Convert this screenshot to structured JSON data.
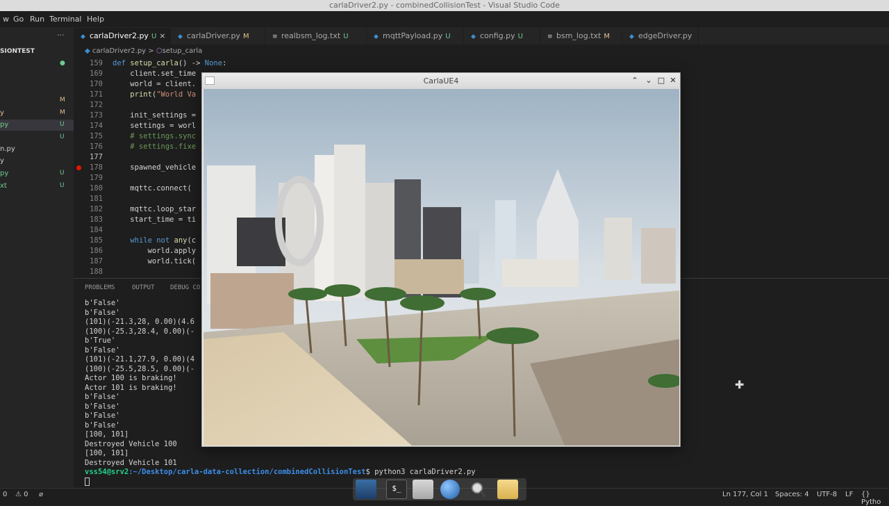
{
  "window": {
    "title": "carlaDriver2.py - combinedCollisionTest - Visual Studio Code"
  },
  "menu": {
    "items": [
      "w",
      "Go",
      "Run",
      "Terminal",
      "Help"
    ]
  },
  "sidebar": {
    "more": "···",
    "project": "SIONTEST",
    "files": [
      {
        "name": "",
        "status": "",
        "dot": "●"
      },
      {
        "name": "",
        "status": "M"
      },
      {
        "name": "y",
        "status": "M"
      },
      {
        "name": "py",
        "status": "U",
        "selected": true
      },
      {
        "name": "",
        "status": "U"
      },
      {
        "name": "n.py",
        "status": ""
      },
      {
        "name": "y",
        "status": ""
      },
      {
        "name": "py",
        "status": "U"
      },
      {
        "name": "xt",
        "status": "U"
      }
    ]
  },
  "tabs": [
    {
      "label": "carlaDriver2.py",
      "status": "U",
      "active": true,
      "close": "×"
    },
    {
      "label": "carlaDriver.py",
      "status": "M"
    },
    {
      "label": "realbsm_log.txt",
      "status": "U"
    },
    {
      "label": "mqttPayload.py",
      "status": "U"
    },
    {
      "label": "config.py",
      "status": "U"
    },
    {
      "label": "bsm_log.txt",
      "status": "M"
    },
    {
      "label": "edgeDriver.py",
      "status": ""
    }
  ],
  "breadcrumb": {
    "file": "carlaDriver2.py",
    "sep": ">",
    "symbol": "setup_carla"
  },
  "editor": {
    "lines": [
      {
        "n": "159",
        "parts": [
          [
            "kw",
            "def "
          ],
          [
            "fn",
            "setup_carla"
          ],
          [
            "",
            "() -> "
          ],
          [
            "kw",
            "None"
          ],
          [
            "",
            ":"
          ]
        ]
      },
      {
        "n": "169",
        "parts": [
          [
            "",
            "    client.set_time"
          ]
        ]
      },
      {
        "n": "170",
        "parts": [
          [
            "",
            "    world = client."
          ]
        ]
      },
      {
        "n": "171",
        "parts": [
          [
            "",
            "    "
          ],
          [
            "fn",
            "print"
          ],
          [
            "",
            "("
          ],
          [
            "str",
            "\"World Va"
          ]
        ]
      },
      {
        "n": "172",
        "parts": []
      },
      {
        "n": "173",
        "parts": [
          [
            "",
            "    init_settings ="
          ]
        ]
      },
      {
        "n": "174",
        "parts": [
          [
            "",
            "    settings = worl"
          ]
        ]
      },
      {
        "n": "175",
        "parts": [
          [
            "cm",
            "    # settings.sync"
          ]
        ]
      },
      {
        "n": "176",
        "parts": [
          [
            "cm",
            "    # settings.fixe"
          ]
        ]
      },
      {
        "n": "177",
        "parts": [],
        "current": true
      },
      {
        "n": "178",
        "parts": [
          [
            "",
            "    spawned_vehicle"
          ]
        ],
        "breakpoint": true
      },
      {
        "n": "179",
        "parts": []
      },
      {
        "n": "180",
        "parts": [
          [
            "",
            "    mqttc.connect("
          ]
        ]
      },
      {
        "n": "181",
        "parts": []
      },
      {
        "n": "182",
        "parts": [
          [
            "",
            "    mqttc.loop_star"
          ]
        ]
      },
      {
        "n": "183",
        "parts": [
          [
            "",
            "    start_time = ti"
          ]
        ]
      },
      {
        "n": "184",
        "parts": []
      },
      {
        "n": "185",
        "parts": [
          [
            "",
            "    "
          ],
          [
            "kw",
            "while not "
          ],
          [
            "fn",
            "any"
          ],
          [
            "",
            "(c"
          ]
        ]
      },
      {
        "n": "186",
        "parts": [
          [
            "",
            "        world.apply"
          ]
        ]
      },
      {
        "n": "187",
        "parts": [
          [
            "",
            "        world.tick("
          ]
        ]
      },
      {
        "n": "188",
        "parts": []
      }
    ]
  },
  "panel": {
    "tabs": [
      "PROBLEMS",
      "OUTPUT",
      "DEBUG CO"
    ],
    "terminal": [
      "b'False'",
      "b'False'",
      "(101)(-21.3,28, 0.00)(4.6",
      "(100)(-25.3,28.4, 0.00)(-",
      "b'True'",
      "b'False'",
      "(101)(-21.1,27.9, 0.00)(4",
      "(100)(-25.5,28.5, 0.00)(-",
      "Actor 100 is braking!",
      "Actor 101 is braking!",
      "b'False'",
      "b'False'",
      "b'False'",
      "b'False'",
      "[100, 101]",
      "Destroyed Vehicle 100",
      "[100, 101]",
      "Destroyed Vehicle 101"
    ],
    "prompt_user": "vss54@srv2",
    "prompt_path": ":~/Desktop/carla-data-collection/combinedCollisionTest",
    "prompt_cmd": "$ python3 carlaDriver2.py"
  },
  "carla": {
    "title": "CarlaUE4",
    "btn_min": "⌃",
    "btn_restore": "⌄",
    "btn_max": "□",
    "btn_close": "✕"
  },
  "statusbar": {
    "left1": "0",
    "left2": "⚠ 0",
    "cursor": "Ln 177, Col 1",
    "spaces": "Spaces: 4",
    "encoding": "UTF-8",
    "eol": "LF",
    "lang": "{} Pytho"
  },
  "dock": {
    "shell_label": "$_"
  },
  "colors": {
    "accent": "#007acc",
    "modified": "#e2c08d",
    "untracked": "#73c991"
  }
}
